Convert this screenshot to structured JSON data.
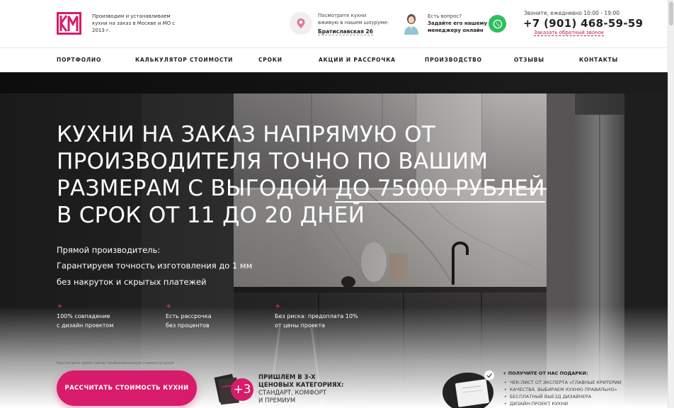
{
  "header": {
    "logo_text": "КМ",
    "tagline": "Производим и устанавливаем кухни на заказ в Москве и МО с 2013 г.",
    "showroom_text_1": "Посмотрите кухни",
    "showroom_text_2": "вживую в нашем шоуруме:",
    "showroom_address": "Братиславская 26",
    "question_title": "Есть вопрос?",
    "question_text_1": "Задайте его нашему",
    "question_text_2": "менеджеру онлайн",
    "hours": "Звоните, ежедневно 10:00 - 19:00",
    "phone": "+7 (901) 468-59-59",
    "callback": "Заказать обратный звонок"
  },
  "nav": {
    "items": [
      "ПОРТФОЛИО",
      "КАЛЬКУЛЯТОР СТОИМОСТИ",
      "СРОКИ",
      "АКЦИИ И РАССРОЧКА",
      "ПРОИЗВОДСТВО",
      "ОТЗЫВЫ",
      "КОНТАКТЫ"
    ]
  },
  "hero": {
    "headline_1": "КУХНИ НА ЗАКАЗ НАПРЯМУЮ ОТ",
    "headline_2": "ПРОИЗВОДИТЕЛЯ ТОЧНО ПО ВАШИМ",
    "headline_3a": "РАЗМЕРАМ С ВЫГОДОЙ ",
    "headline_3b": "ДО 75000 РУБЛЕЙ",
    "headline_4": "В СРОК ОТ 11 ДО 20 ДНЕЙ",
    "sub_1": "Прямой производитель:",
    "sub_2": "Гарантируем точность изготовления до 1 мм",
    "sub_3": "без накруток и скрытых платежей",
    "features": [
      {
        "line1": "100% совпадение",
        "line2": "с дизайн проектом"
      },
      {
        "line1": "Есть рассрочка",
        "line2": "без процентов"
      },
      {
        "line1": "Без риска: предоплата 10%",
        "line2": "от цены проекта"
      }
    ],
    "small_note": "Рассчитайте прямо сейчас приблизительную стоимость кухни",
    "cta": "РАССЧИТАТЬ СТОИМОСТЬ КУХНИ",
    "plus3": "+3",
    "price_1": "ПРИШЛЕМ В 3-Х",
    "price_2": "ЦЕНОВЫХ КАТЕГОРИЯХ:",
    "price_3": "СТАНДАРТ, КОМФОРТ",
    "price_4": "И ПРЕМИУМ",
    "gifts_title": "+ ПОЛУЧИТЕ ОТ НАС ПОДАРКИ:",
    "gifts": [
      "ЧЕК-ЛИСТ ОТ ЭКСПЕРТА «ГЛАВНЫЕ КРИТЕРИИ",
      "КАЧЕСТВА. ВЫБИРАЕМ КУХНЮ ПРАВИЛЬНО»",
      "БЕСПЛАТНЫЙ ВЫЕЗД ДИЗАЙНЕРА",
      "ДИЗАЙН-ПРОЕКТ КУХНИ"
    ]
  },
  "colors": {
    "accent": "#d81b6a",
    "whatsapp": "#2fbe5e",
    "text": "#222222"
  }
}
